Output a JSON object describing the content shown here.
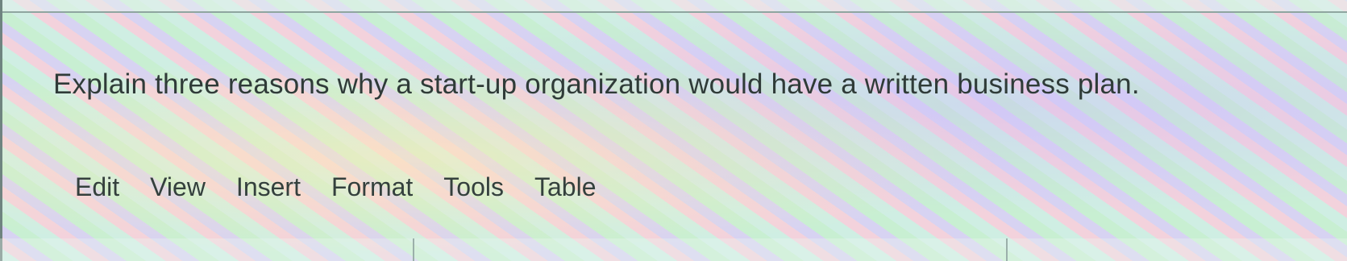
{
  "question": {
    "text": "Explain three reasons why a start-up organization would have a written business plan."
  },
  "editor": {
    "menu": [
      {
        "label": "Edit"
      },
      {
        "label": "View"
      },
      {
        "label": "Insert"
      },
      {
        "label": "Format"
      },
      {
        "label": "Tools"
      },
      {
        "label": "Table"
      }
    ]
  }
}
